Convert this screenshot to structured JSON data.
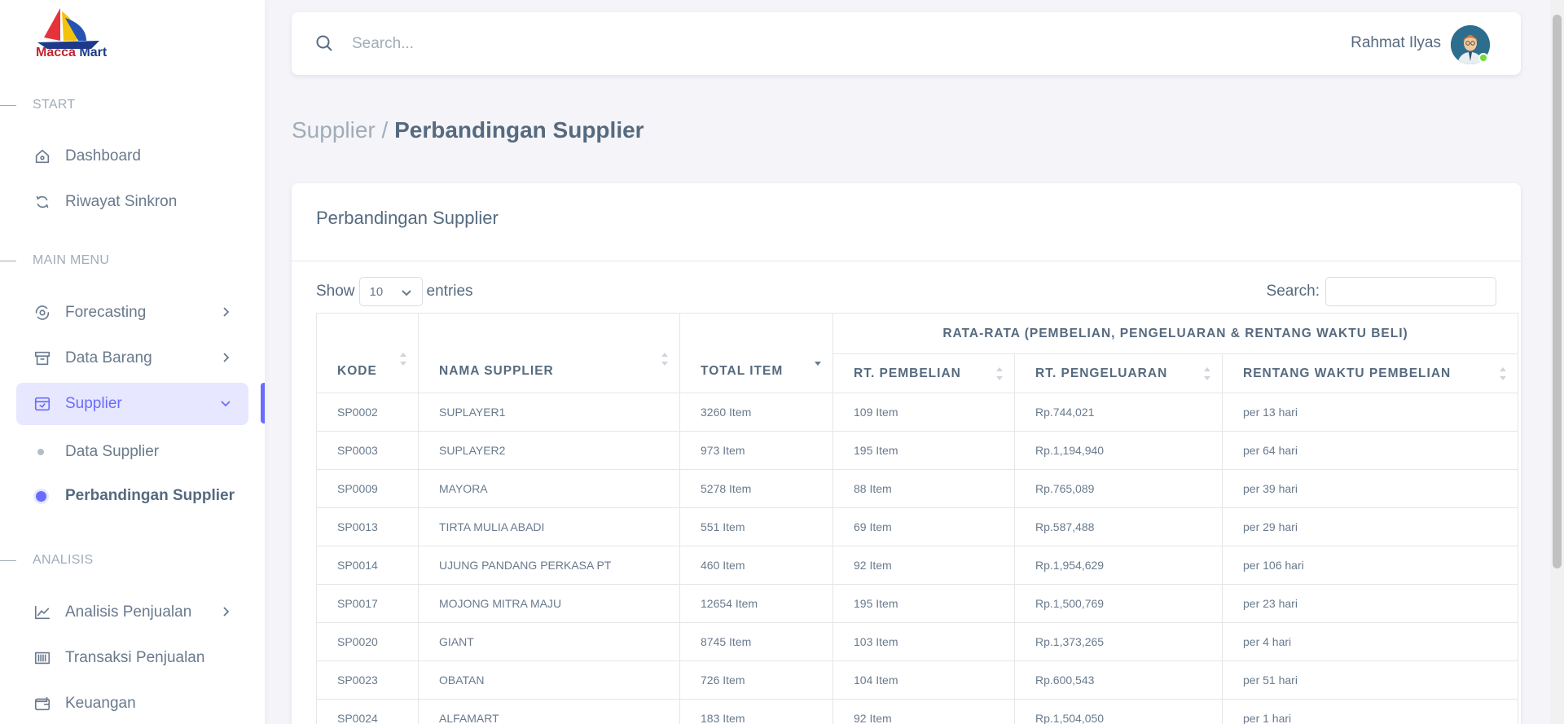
{
  "app": {
    "logo": {
      "part1": "Macca",
      "part2": "Mart"
    }
  },
  "sidebar": {
    "sections": [
      {
        "header": "START"
      },
      {
        "header": "MAIN MENU"
      },
      {
        "header": "ANALISIS"
      }
    ],
    "items": [
      {
        "label": "Dashboard",
        "icon": "home-icon"
      },
      {
        "label": "Riwayat Sinkron",
        "icon": "sync-icon"
      },
      {
        "label": "Forecasting",
        "icon": "forecast-icon"
      },
      {
        "label": "Data Barang",
        "icon": "archive-icon"
      },
      {
        "label": "Supplier",
        "icon": "supplier-box-icon",
        "active": true
      },
      {
        "label": "Analisis Penjualan",
        "icon": "line-chart-icon"
      },
      {
        "label": "Transaksi Penjualan",
        "icon": "barcode-icon"
      },
      {
        "label": "Keuangan",
        "icon": "wallet-icon"
      }
    ],
    "subitems": [
      {
        "label": "Data Supplier"
      },
      {
        "label": "Perbandingan Supplier",
        "active": true
      }
    ],
    "accent_color": "#696cff"
  },
  "navbar": {
    "search_placeholder": "Search...",
    "user_name": "Rahmat Ilyas",
    "status_color": "#71dd37"
  },
  "breadcrumb": {
    "parent": "Supplier /",
    "current": "Perbandingan Supplier"
  },
  "card": {
    "title": "Perbandingan Supplier",
    "show_label": "Show",
    "entries_value": "10",
    "entries_label": "entries",
    "search_label": "Search:"
  },
  "table": {
    "group_header": "RATA-RATA (PEMBELIAN, PENGELUARAN & RENTANG WAKTU BELI)",
    "columns": [
      "KODE",
      "NAMA SUPPLIER",
      "TOTAL ITEM",
      "RT. PEMBELIAN",
      "RT. PENGELUARAN",
      "RENTANG WAKTU PEMBELIAN"
    ],
    "rows": [
      [
        "SP0002",
        "SUPLAYER1",
        "3260 Item",
        "109 Item",
        "Rp.744,021",
        "per 13 hari"
      ],
      [
        "SP0003",
        "SUPLAYER2",
        "973 Item",
        "195 Item",
        "Rp.1,194,940",
        "per 64 hari"
      ],
      [
        "SP0009",
        "MAYORA",
        "5278 Item",
        "88 Item",
        "Rp.765,089",
        "per 39 hari"
      ],
      [
        "SP0013",
        "TIRTA MULIA ABADI",
        "551 Item",
        "69 Item",
        "Rp.587,488",
        "per 29 hari"
      ],
      [
        "SP0014",
        "UJUNG PANDANG PERKASA PT",
        "460 Item",
        "92 Item",
        "Rp.1,954,629",
        "per 106 hari"
      ],
      [
        "SP0017",
        "MOJONG MITRA MAJU",
        "12654 Item",
        "195 Item",
        "Rp.1,500,769",
        "per 23 hari"
      ],
      [
        "SP0020",
        "GIANT",
        "8745 Item",
        "103 Item",
        "Rp.1,373,265",
        "per 4 hari"
      ],
      [
        "SP0023",
        "OBATAN",
        "726 Item",
        "104 Item",
        "Rp.600,543",
        "per 51 hari"
      ],
      [
        "SP0024",
        "ALFAMART",
        "183 Item",
        "92 Item",
        "Rp.1,504,050",
        "per 1 hari"
      ]
    ]
  }
}
